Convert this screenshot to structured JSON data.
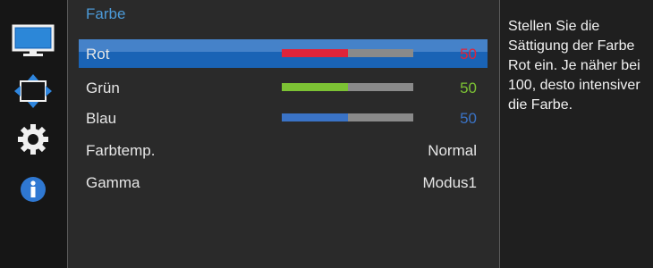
{
  "sidebar": {
    "icons": [
      {
        "name": "display-icon"
      },
      {
        "name": "size-position-icon"
      },
      {
        "name": "settings-gear-icon"
      },
      {
        "name": "info-icon"
      }
    ]
  },
  "menu": {
    "section_title": "Farbe",
    "items": [
      {
        "label": "Rot",
        "value": "50",
        "level": 50,
        "color": "#e0243a",
        "value_color": "#e0243a",
        "selected": true
      },
      {
        "label": "Grün",
        "value": "50",
        "level": 50,
        "color": "#7cc234",
        "value_color": "#7cc234",
        "selected": false
      },
      {
        "label": "Blau",
        "value": "50",
        "level": 50,
        "color": "#3a73c6",
        "value_color": "#3a73c6",
        "selected": false
      },
      {
        "label": "Farbtemp.",
        "value": "Normal"
      },
      {
        "label": "Gamma",
        "value": "Modus1"
      }
    ]
  },
  "description": {
    "text": "Stellen Sie die Sättigung der Farbe Rot ein. Je näher bei 100, desto intensiver die Farbe."
  },
  "colors": {
    "accent": "#1a63b5",
    "title": "#4c9ad8"
  }
}
